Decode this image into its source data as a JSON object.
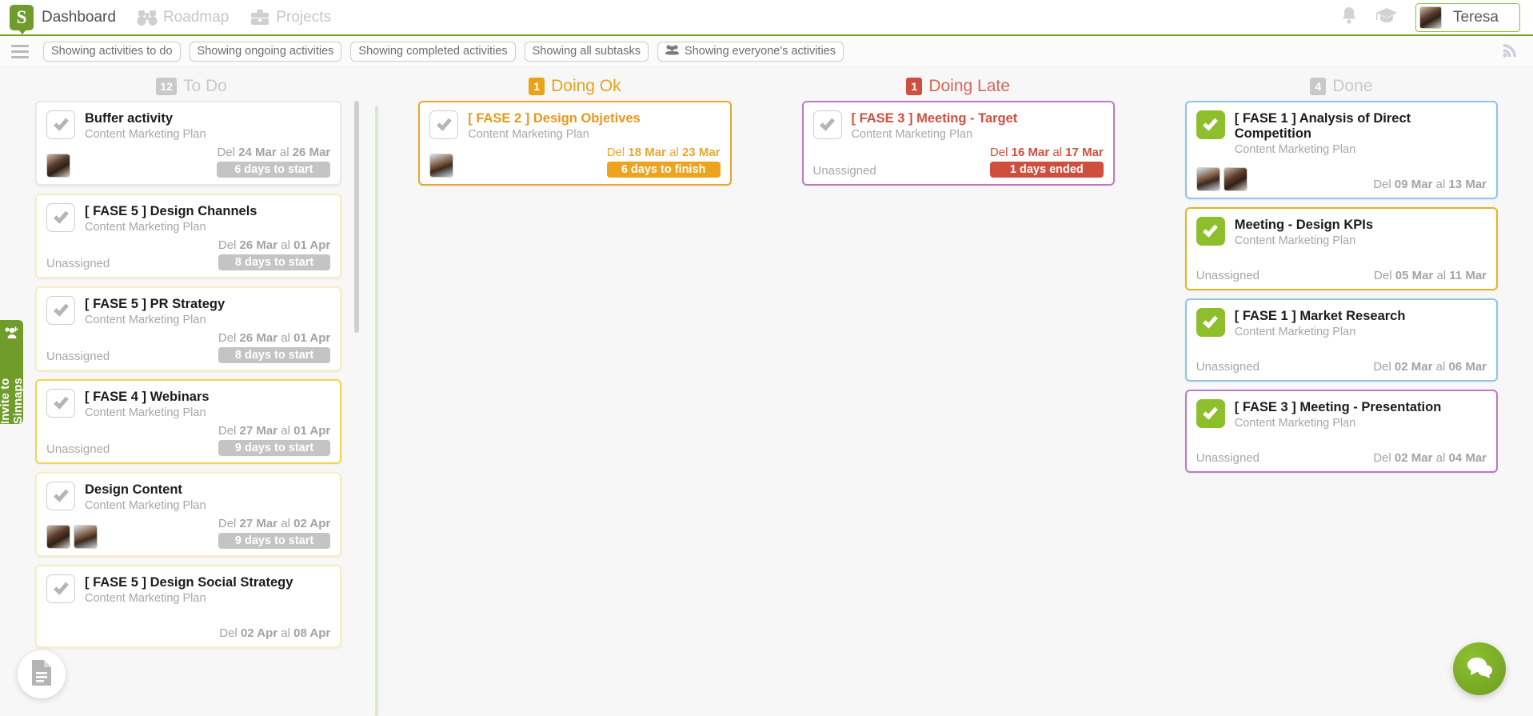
{
  "nav": {
    "logo_letter": "S",
    "items": [
      {
        "label": "Dashboard",
        "icon": "dashboard-icon",
        "active": true
      },
      {
        "label": "Roadmap",
        "icon": "binoculars-icon",
        "active": false
      },
      {
        "label": "Projects",
        "icon": "briefcase-icon",
        "active": false
      }
    ],
    "bell_icon": "bell-icon",
    "graduation_icon": "graduation-cap-icon",
    "user": {
      "name": "Teresa",
      "avatar": "user-avatar"
    }
  },
  "filters": {
    "menu_icon": "hamburger-menu-icon",
    "rss_icon": "rss-icon",
    "chips": [
      {
        "label": "Showing activities to do",
        "icon": null
      },
      {
        "label": "Showing ongoing activities",
        "icon": null
      },
      {
        "label": "Showing completed activities",
        "icon": null
      },
      {
        "label": "Showing all subtasks",
        "icon": null
      },
      {
        "label": "Showing everyone's activities",
        "icon": "people-group-icon"
      }
    ]
  },
  "left_rail": {
    "invite_label": "Invite to Sinnaps",
    "invite_icon": "add-user-icon",
    "doc_fab_icon": "document-icon",
    "chat_fab_icon": "chat-bubble-icon"
  },
  "columns": [
    {
      "id": "todo",
      "title": "To Do",
      "count": "12",
      "count_bg": "#c9c9c9",
      "title_color": "#c9c9c9",
      "cards": [
        {
          "title": "Buffer activity",
          "subtitle": "Content Marketing Plan",
          "title_color": "#1c1c1c",
          "border": "#e8e8e8",
          "checkbox": "unchecked",
          "assignees": [
            "a1"
          ],
          "unassigned_label": null,
          "date_prefix": "Del",
          "date_start": "24 Mar",
          "date_mid": "al",
          "date_end": "26 Mar",
          "date_color": "#a3a3a3",
          "badge": "6 days to start",
          "badge_bg": "#c4c4c4"
        },
        {
          "title": "[ FASE 5 ]  Design Channels",
          "subtitle": "Content Marketing Plan",
          "title_color": "#1c1c1c",
          "border": "#f6eec2",
          "checkbox": "unchecked",
          "assignees": [],
          "unassigned_label": "Unassigned",
          "date_prefix": "Del",
          "date_start": "26 Mar",
          "date_mid": "al",
          "date_end": "01 Apr",
          "date_color": "#a3a3a3",
          "badge": "8 days to start",
          "badge_bg": "#c4c4c4"
        },
        {
          "title": "[ FASE 5 ] PR Strategy",
          "subtitle": "Content Marketing Plan",
          "title_color": "#1c1c1c",
          "border": "#f6eec2",
          "checkbox": "unchecked",
          "assignees": [],
          "unassigned_label": "Unassigned",
          "date_prefix": "Del",
          "date_start": "26 Mar",
          "date_mid": "al",
          "date_end": "01 Apr",
          "date_color": "#a3a3a3",
          "badge": "8 days to start",
          "badge_bg": "#c4c4c4"
        },
        {
          "title": "[ FASE 4 ] Webinars",
          "subtitle": "Content Marketing Plan",
          "title_color": "#1c1c1c",
          "border": "#f3d44e",
          "checkbox": "unchecked",
          "assignees": [],
          "unassigned_label": "Unassigned",
          "date_prefix": "Del",
          "date_start": "27 Mar",
          "date_mid": "al",
          "date_end": "01 Apr",
          "date_color": "#a3a3a3",
          "badge": "9 days to start",
          "badge_bg": "#c4c4c4"
        },
        {
          "title": "Design Content",
          "subtitle": "Content Marketing Plan",
          "title_color": "#1c1c1c",
          "border": "#f6eec2",
          "checkbox": "unchecked",
          "assignees": [
            "a1",
            "a2"
          ],
          "unassigned_label": null,
          "date_prefix": "Del",
          "date_start": "27 Mar",
          "date_mid": "al",
          "date_end": "02 Apr",
          "date_color": "#a3a3a3",
          "badge": "9 days to start",
          "badge_bg": "#c4c4c4"
        },
        {
          "title": "[ FASE 5 ] Design Social Strategy",
          "subtitle": "Content Marketing Plan",
          "title_color": "#1c1c1c",
          "border": "#f6eec2",
          "checkbox": "unchecked",
          "assignees": [],
          "unassigned_label": null,
          "date_prefix": "Del",
          "date_start": "02 Apr",
          "date_mid": "al",
          "date_end": "08 Apr",
          "date_color": "#a3a3a3",
          "badge": null,
          "badge_bg": null
        }
      ]
    },
    {
      "id": "doing-ok",
      "title": "Doing Ok",
      "count": "1",
      "count_bg": "#e8a317",
      "title_color": "#e8a317",
      "cards": [
        {
          "title": "[ FASE 2 ] Design Objetives",
          "subtitle": "Content Marketing Plan",
          "title_color": "#e8971a",
          "border": "#e8a830",
          "checkbox": "unchecked",
          "assignees": [
            "a2"
          ],
          "unassigned_label": null,
          "date_prefix": "Del",
          "date_start": "18 Mar",
          "date_mid": "al",
          "date_end": "23 Mar",
          "date_color": "#e8a830",
          "badge": "6 days to finish",
          "badge_bg": "#eda31d"
        }
      ]
    },
    {
      "id": "doing-late",
      "title": "Doing Late",
      "count": "1",
      "count_bg": "#cf4f3e",
      "title_color": "#d4685a",
      "cards": [
        {
          "title": "[ FASE 3 ]  Meeting - Target",
          "subtitle": "Content Marketing Plan",
          "title_color": "#cf4f3e",
          "border": "#bd79c4",
          "checkbox": "unchecked",
          "assignees": [],
          "unassigned_label": "Unassigned",
          "date_prefix": "Del",
          "date_start": "16 Mar",
          "date_mid": "al",
          "date_end": "17 Mar",
          "date_color": "#cf4f3e",
          "badge": "1 days ended",
          "badge_bg": "#cf4f3e"
        }
      ]
    },
    {
      "id": "done",
      "title": "Done",
      "count": "4",
      "count_bg": "#c9c9c9",
      "title_color": "#c9c9c9",
      "cards": [
        {
          "title": "[ FASE 1 ] Analysis of Direct Competition",
          "subtitle": "Content Marketing Plan",
          "title_color": "#1c1c1c",
          "border": "#8ec5ea",
          "checkbox": "done",
          "assignees": [
            "a2",
            "a1"
          ],
          "unassigned_label": null,
          "date_prefix": "Del",
          "date_start": "09 Mar",
          "date_mid": "al",
          "date_end": "13 Mar",
          "date_color": "#a3a3a3",
          "badge": null,
          "badge_bg": null
        },
        {
          "title": "Meeting - Design KPIs",
          "subtitle": "Content Marketing Plan",
          "title_color": "#1c1c1c",
          "border": "#e0b526",
          "checkbox": "done",
          "assignees": [],
          "unassigned_label": "Unassigned",
          "date_prefix": "Del",
          "date_start": "05 Mar",
          "date_mid": "al",
          "date_end": "11 Mar",
          "date_color": "#a3a3a3",
          "badge": null,
          "badge_bg": null
        },
        {
          "title": "[ FASE 1 ] Market Research",
          "subtitle": "Content Marketing Plan",
          "title_color": "#1c1c1c",
          "border": "#8ec5ea",
          "checkbox": "done",
          "assignees": [],
          "unassigned_label": "Unassigned",
          "date_prefix": "Del",
          "date_start": "02 Mar",
          "date_mid": "al",
          "date_end": "06 Mar",
          "date_color": "#a3a3a3",
          "badge": null,
          "badge_bg": null
        },
        {
          "title": "[ FASE 3 ] Meeting - Presentation",
          "subtitle": "Content Marketing Plan",
          "title_color": "#1c1c1c",
          "border": "#bd79c4",
          "checkbox": "done",
          "assignees": [],
          "unassigned_label": "Unassigned",
          "date_prefix": "Del",
          "date_start": "02 Mar",
          "date_mid": "al",
          "date_end": "04 Mar",
          "date_color": "#a3a3a3",
          "badge": null,
          "badge_bg": null
        }
      ]
    }
  ]
}
